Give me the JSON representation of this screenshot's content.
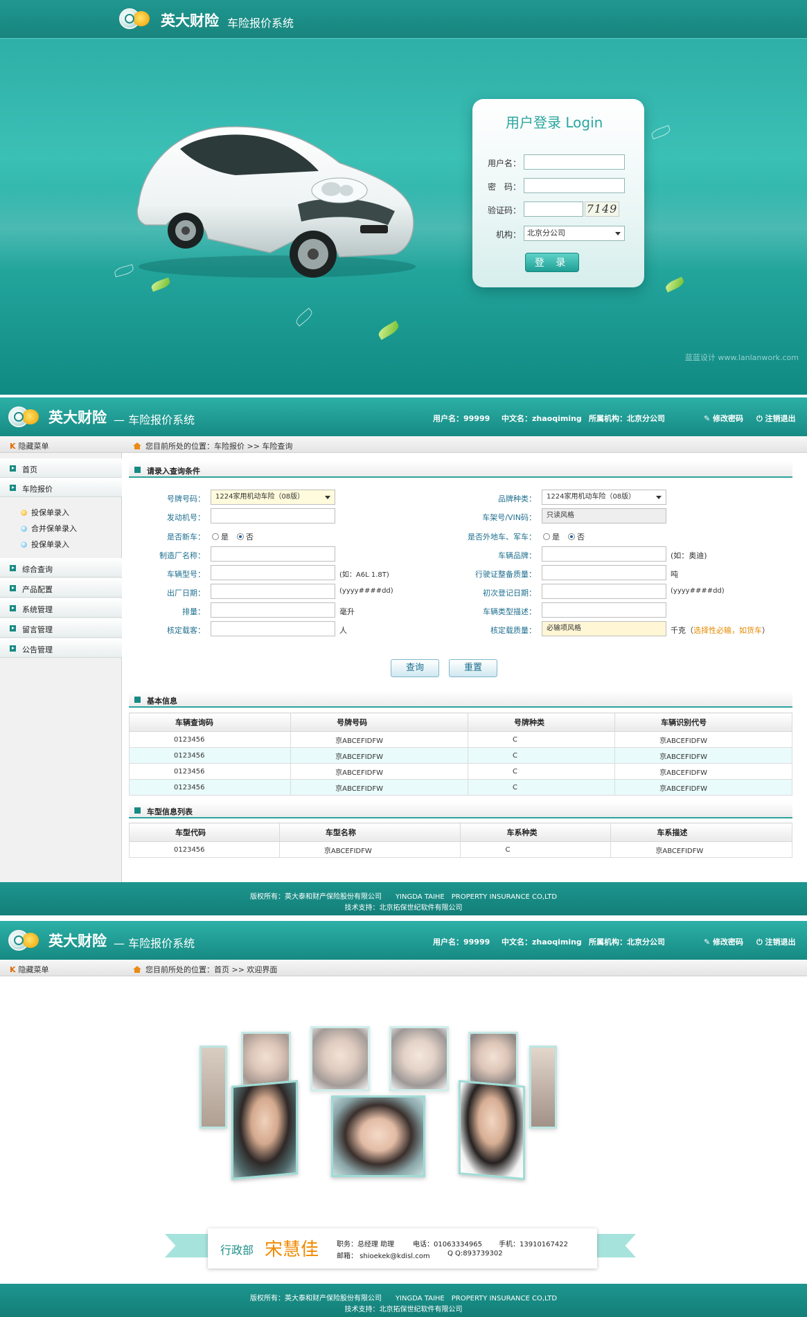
{
  "brand": {
    "name": "英大财险",
    "system": "车险报价系统",
    "system_dash": "— 车险报价系统"
  },
  "login": {
    "title": "用户登录 Login",
    "username_label": "用户名：",
    "username_value": "",
    "password_label": "密　码：",
    "password_value": "",
    "captcha_label": "验证码：",
    "captcha_value": "",
    "captcha_text": "7149",
    "org_label": "机构：",
    "org_selected": "北京分公司",
    "submit": "登 录",
    "watermark": "蓝蓝设计 www.lanlanwork.com"
  },
  "header": {
    "username": "用户名：99999",
    "cn_name": "中文名：zhaoqiming",
    "org": "所属机构：北京分公司",
    "change_pwd": "修改密码",
    "logout": "注销退出"
  },
  "menu_toggle": "隐藏菜单",
  "breadcrumb_query": "您目前所处的位置：车险报价 >> 车险查询",
  "breadcrumb_welcome": "您目前所处的位置：首页 >> 欢迎界面",
  "sidebar": {
    "items": [
      "首页",
      "车险报价",
      "综合查询",
      "产品配置",
      "系统管理",
      "留言管理",
      "公告管理"
    ],
    "subitems": [
      "投保单录入",
      "合并保单录入",
      "投保单录入"
    ]
  },
  "query_form": {
    "title": "请录入查询条件",
    "plate_type_label": "号牌号码：",
    "plate_type_value": "1224家用机动车险（08版）",
    "brand_type_label": "品牌种类：",
    "brand_type_value": "1224家用机动车险（08版）",
    "engine_label": "发动机号：",
    "vin_label": "车架号/VIN码：",
    "vin_value": "只读风格",
    "new_car_label": "是否新车：",
    "foreign_label": "是否外地车、军车：",
    "yes": "是",
    "no": "否",
    "maker_label": "制造厂名称：",
    "car_brand_label": "车辆品牌：",
    "car_brand_hint": "(如：奥迪)",
    "model_label": "车辆型号：",
    "model_hint": "(如：A6L 1.8T)",
    "license_mass_label": "行驶证整备质量：",
    "ton": "吨",
    "factory_date_label": "出厂日期：",
    "date_hint": "(yyyy####dd)",
    "first_reg_label": "初次登记日期：",
    "displacement_label": "排量：",
    "ml": "毫升",
    "car_desc_label": "车辆类型描述：",
    "seats_label": "核定载客：",
    "people": "人",
    "load_label": "核定载质量：",
    "load_value": "必输项风格",
    "kg": "千克",
    "load_note_open": "（",
    "load_note": "选择性必输，如货车",
    "load_note_close": "）",
    "query_btn": "查询",
    "reset_btn": "重置"
  },
  "basic_info": {
    "title": "基本信息",
    "headers": [
      "车辆查询码",
      "号牌号码",
      "号牌种类",
      "车辆识别代号"
    ],
    "rows": [
      [
        "0123456",
        "京ABCEFIDFW",
        "C",
        "京ABCEFIDFW"
      ],
      [
        "0123456",
        "京ABCEFIDFW",
        "C",
        "京ABCEFIDFW"
      ],
      [
        "0123456",
        "京ABCEFIDFW",
        "C",
        "京ABCEFIDFW"
      ],
      [
        "0123456",
        "京ABCEFIDFW",
        "C",
        "京ABCEFIDFW"
      ]
    ]
  },
  "model_list": {
    "title": "车型信息列表",
    "headers": [
      "车型代码",
      "车型名称",
      "车系种类",
      "车系描述"
    ],
    "rows": [
      [
        "0123456",
        "京ABCEFIDFW",
        "C",
        "京ABCEFIDFW"
      ]
    ]
  },
  "footer": {
    "line1": "版权所有：英大泰和财产保险股份有限公司　　YINGDA TAIHE　PROPERTY INSURANCE CO,LTD",
    "line2": "技术支持：北京拓保世纪软件有限公司"
  },
  "profile": {
    "dept": "行政部",
    "name": "宋慧佳",
    "title": "职务：总经理 助理",
    "phone": "电话：01063334965",
    "mobile": "手机：13910167422",
    "email": "邮箱： shioekek@kdisl.com",
    "qq": "Q Q:893739302"
  },
  "colors": {
    "teal": "#1f9790",
    "accent": "#e68a00"
  }
}
